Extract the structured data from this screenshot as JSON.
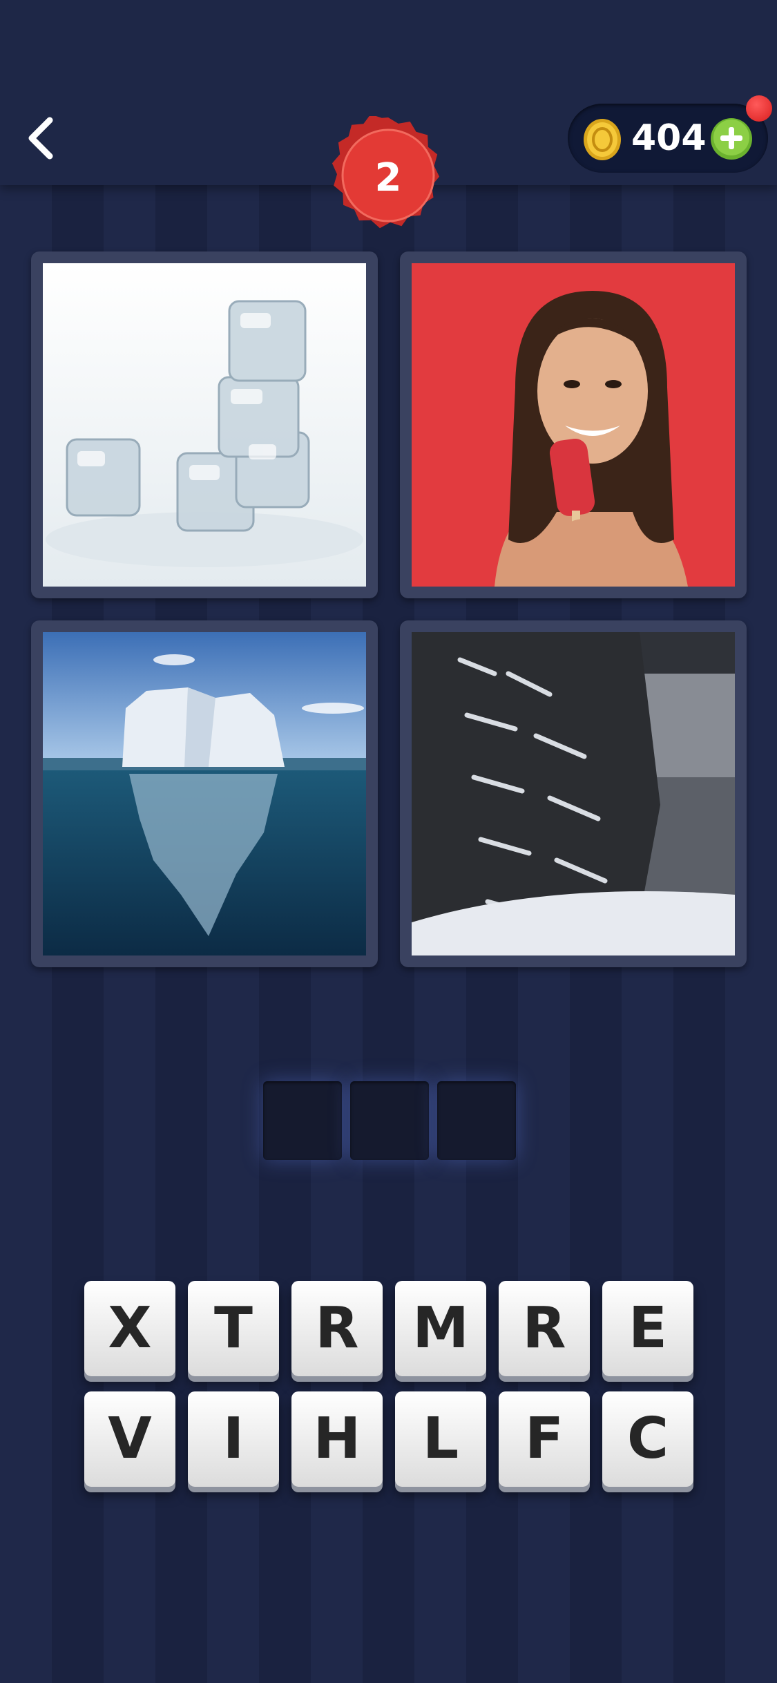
{
  "header": {
    "level": "2",
    "coins": "404"
  },
  "puzzle": {
    "pictures": [
      "ice-cubes",
      "popsicle-woman",
      "iceberg",
      "snowy-tire"
    ],
    "answer_slots": [
      "",
      "",
      ""
    ]
  },
  "keyboard": {
    "row1": [
      "X",
      "T",
      "R",
      "M",
      "R",
      "E"
    ],
    "row2": [
      "V",
      "I",
      "H",
      "L",
      "F",
      "C"
    ]
  },
  "colors": {
    "background": "#1c2444",
    "level_badge": "#e33a35",
    "coin": "#f2c530",
    "add_button": "#7cc53a",
    "notification": "#e52a2a"
  }
}
